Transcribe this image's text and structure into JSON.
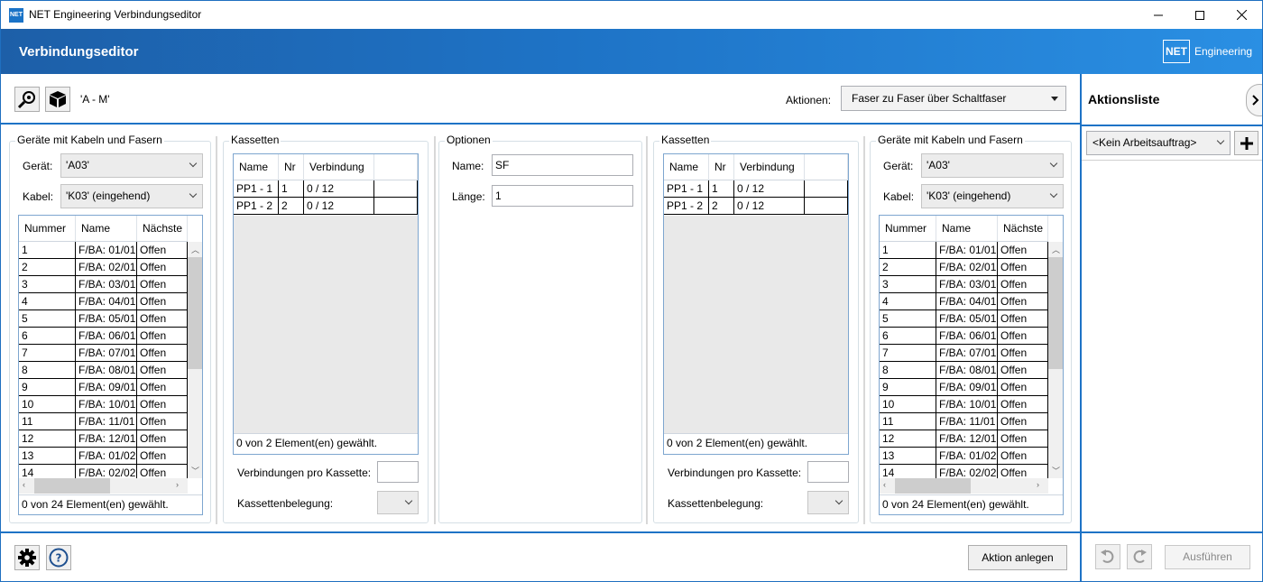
{
  "window": {
    "icon_text": "NET",
    "title": "NET Engineering Verbindungseditor",
    "minimize": "—",
    "maximize": "☐",
    "close": "✕"
  },
  "header": {
    "title": "Verbindungseditor",
    "logo_net": "NET",
    "logo_text": "Engineering"
  },
  "toolbar": {
    "path": "'A - M'",
    "actions_label": "Aktionen:",
    "actions_value": "Faser zu Faser über Schaltfaser"
  },
  "left_devices": {
    "title": "Geräte mit Kabeln und Fasern",
    "device_label": "Gerät:",
    "device_value": "'A03'",
    "cable_label": "Kabel:",
    "cable_value": "'K03' (eingehend)",
    "columns": [
      "Nummer",
      "Name",
      "Nächste"
    ],
    "rows": [
      [
        "1",
        "F/BA: 01/01",
        "Offen"
      ],
      [
        "2",
        "F/BA: 02/01",
        "Offen"
      ],
      [
        "3",
        "F/BA: 03/01",
        "Offen"
      ],
      [
        "4",
        "F/BA: 04/01",
        "Offen"
      ],
      [
        "5",
        "F/BA: 05/01",
        "Offen"
      ],
      [
        "6",
        "F/BA: 06/01",
        "Offen"
      ],
      [
        "7",
        "F/BA: 07/01",
        "Offen"
      ],
      [
        "8",
        "F/BA: 08/01",
        "Offen"
      ],
      [
        "9",
        "F/BA: 09/01",
        "Offen"
      ],
      [
        "10",
        "F/BA: 10/01",
        "Offen"
      ],
      [
        "11",
        "F/BA: 11/01",
        "Offen"
      ],
      [
        "12",
        "F/BA: 12/01",
        "Offen"
      ],
      [
        "13",
        "F/BA: 01/02",
        "Offen"
      ],
      [
        "14",
        "F/BA: 02/02",
        "Offen"
      ]
    ],
    "footer": "0 von 24 Element(en) gewählt."
  },
  "left_cassettes": {
    "title": "Kassetten",
    "columns": [
      "Name",
      "Nr",
      "Verbindung"
    ],
    "rows": [
      [
        "PP1 - 1",
        "1",
        "0 / 12"
      ],
      [
        "PP1 - 2",
        "2",
        "0 / 12"
      ]
    ],
    "footer": "0 von 2 Element(en) gewählt.",
    "per_cassette_label": "Verbindungen pro Kassette:",
    "allocation_label": "Kassettenbelegung:"
  },
  "options": {
    "title": "Optionen",
    "name_label": "Name:",
    "name_value": "SF",
    "length_label": "Länge:",
    "length_value": "1"
  },
  "right_cassettes": {
    "title": "Kassetten",
    "columns": [
      "Name",
      "Nr",
      "Verbindung"
    ],
    "rows": [
      [
        "PP1 - 1",
        "1",
        "0 / 12"
      ],
      [
        "PP1 - 2",
        "2",
        "0 / 12"
      ]
    ],
    "footer": "0 von 2 Element(en) gewählt.",
    "per_cassette_label": "Verbindungen pro Kassette:",
    "allocation_label": "Kassettenbelegung:"
  },
  "right_devices": {
    "title": "Geräte mit Kabeln und Fasern",
    "device_label": "Gerät:",
    "device_value": "'A03'",
    "cable_label": "Kabel:",
    "cable_value": "'K03' (eingehend)",
    "columns": [
      "Nummer",
      "Name",
      "Nächste"
    ],
    "rows": [
      [
        "1",
        "F/BA: 01/01",
        "Offen"
      ],
      [
        "2",
        "F/BA: 02/01",
        "Offen"
      ],
      [
        "3",
        "F/BA: 03/01",
        "Offen"
      ],
      [
        "4",
        "F/BA: 04/01",
        "Offen"
      ],
      [
        "5",
        "F/BA: 05/01",
        "Offen"
      ],
      [
        "6",
        "F/BA: 06/01",
        "Offen"
      ],
      [
        "7",
        "F/BA: 07/01",
        "Offen"
      ],
      [
        "8",
        "F/BA: 08/01",
        "Offen"
      ],
      [
        "9",
        "F/BA: 09/01",
        "Offen"
      ],
      [
        "10",
        "F/BA: 10/01",
        "Offen"
      ],
      [
        "11",
        "F/BA: 11/01",
        "Offen"
      ],
      [
        "12",
        "F/BA: 12/01",
        "Offen"
      ],
      [
        "13",
        "F/BA: 01/02",
        "Offen"
      ],
      [
        "14",
        "F/BA: 02/02",
        "Offen"
      ]
    ],
    "footer": "0 von 24 Element(en) gewählt."
  },
  "action_list": {
    "title": "Aktionsliste",
    "work_order_value": "<Kein Arbeitsauftrag>",
    "run_label": "Ausführen"
  },
  "bottom": {
    "create_label": "Aktion anlegen"
  },
  "colors": {
    "accent": "#1e73c6",
    "grid_border": "#7ea6cf"
  }
}
